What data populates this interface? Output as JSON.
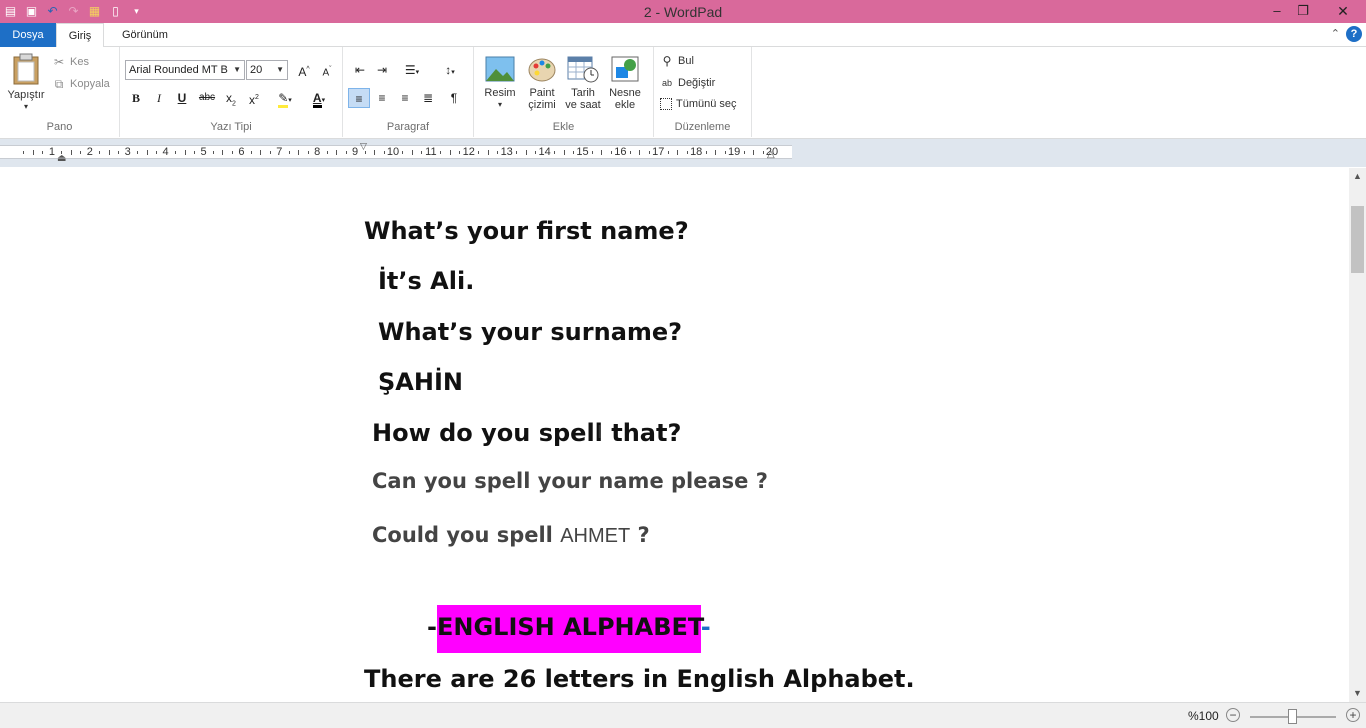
{
  "window": {
    "title": "2 - WordPad",
    "minimize": "–",
    "restore": "❐",
    "close": "✕"
  },
  "tabs": {
    "file": "Dosya",
    "home": "Giriş",
    "view": "Görünüm",
    "help": "?"
  },
  "ribbon": {
    "clipboard": {
      "label": "Pano",
      "paste": "Yapıştır",
      "cut": "Kes",
      "copy": "Kopyala"
    },
    "font": {
      "label": "Yazı Tipi",
      "family": "Arial Rounded MT B",
      "size": "20"
    },
    "paragraph": {
      "label": "Paragraf"
    },
    "insert": {
      "label": "Ekle",
      "picture": "Resim",
      "paint_line1": "Paint",
      "paint_line2": "çizimi",
      "datetime_line1": "Tarih",
      "datetime_line2": "ve saat",
      "object_line1": "Nesne",
      "object_line2": "ekle"
    },
    "editing": {
      "label": "Düzenleme",
      "find": "Bul",
      "replace": "Değiştir",
      "select_all": "Tümünü seç"
    }
  },
  "ruler": {
    "numbers": [
      "1",
      "2",
      "3",
      "4",
      "5",
      "6",
      "7",
      "8",
      "9",
      "10",
      "11",
      "12",
      "13",
      "14",
      "15",
      "16",
      "17",
      "18",
      "19",
      "20"
    ]
  },
  "document": {
    "line1": "What’s your first name?",
    "line2": "İt’s Ali.",
    "line3": "What’s your surname?",
    "line4": "ŞAHİN",
    "line5": "How do you spell that?",
    "line6": "Can you spell your name please ?",
    "line7a": "Could you spell ",
    "line7b": "AHMET",
    "line7c": " ?",
    "line8_dash1": "-",
    "line8": "ENGLISH ALPHABET",
    "line8_dash2": "-",
    "line9": "There are 26 letters in English Alphabet."
  },
  "status": {
    "zoom": "%100"
  },
  "colors": {
    "titlebar": "#d9699b",
    "file_tab": "#1e6fc6",
    "highlight": "#ff00ff"
  }
}
